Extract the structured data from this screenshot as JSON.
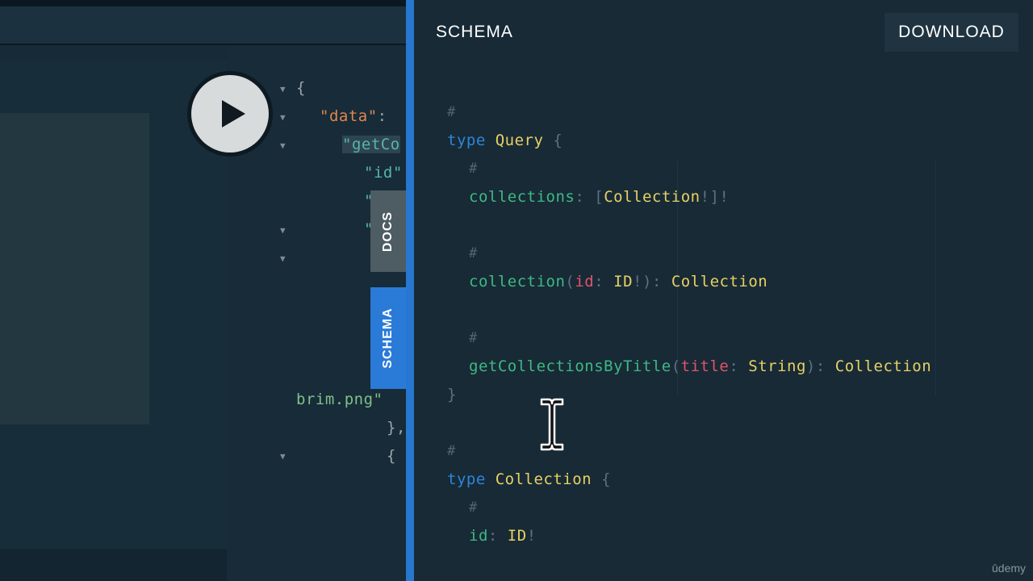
{
  "result": {
    "lines": [
      {
        "open_brace": "{"
      },
      {
        "key": "\"data\"",
        "colon": ":"
      },
      {
        "key": "\"getCo"
      },
      {
        "key": "\"id\""
      },
      {
        "text": "\""
      },
      {
        "text": "\""
      },
      {
        "text": "brim.png\""
      },
      {
        "text": "},"
      },
      {
        "text": "{"
      }
    ]
  },
  "tabs": {
    "docs": "DOCS",
    "schema": "SCHEMA"
  },
  "drawer": {
    "title": "SCHEMA",
    "download": "DOWNLOAD"
  },
  "schema_lines": [
    {
      "comment": "#"
    },
    {
      "kw": "type",
      "name": "Query",
      "brace": "{"
    },
    {
      "comment": "#"
    },
    {
      "field": "collections",
      "colon": ":",
      "lb": "[",
      "type": "Collection",
      "bang": "!",
      "rb": "]",
      "bang2": "!"
    },
    {
      "comment": "#"
    },
    {
      "field": "collection",
      "lp": "(",
      "arg": "id",
      "colon": ":",
      "argtype": "ID",
      "bang": "!",
      "rp": ")",
      "colon2": ":",
      "type": "Collection"
    },
    {
      "comment": "#"
    },
    {
      "field": "getCollectionsByTitle",
      "lp": "(",
      "arg": "title",
      "colon": ":",
      "argtype": "String",
      "rp": ")",
      "colon2": ":",
      "type": "Collection"
    },
    {
      "brace": "}"
    },
    {
      "comment": "#"
    },
    {
      "kw": "type",
      "name": "Collection",
      "brace": "{"
    },
    {
      "comment": "#"
    },
    {
      "field": "id",
      "colon": ":",
      "type": "ID",
      "bang": "!"
    }
  ],
  "watermark": "ūdemy",
  "colors": {
    "accent": "#2a7ad8",
    "keyword": "#2f85d6",
    "type": "#e8d064",
    "field": "#3fb883",
    "argument": "#e0546a",
    "comment": "#4e6673"
  },
  "icons": {
    "play": "play-icon",
    "fold": "triangle-down-icon",
    "cursor": "text-cursor-icon"
  }
}
